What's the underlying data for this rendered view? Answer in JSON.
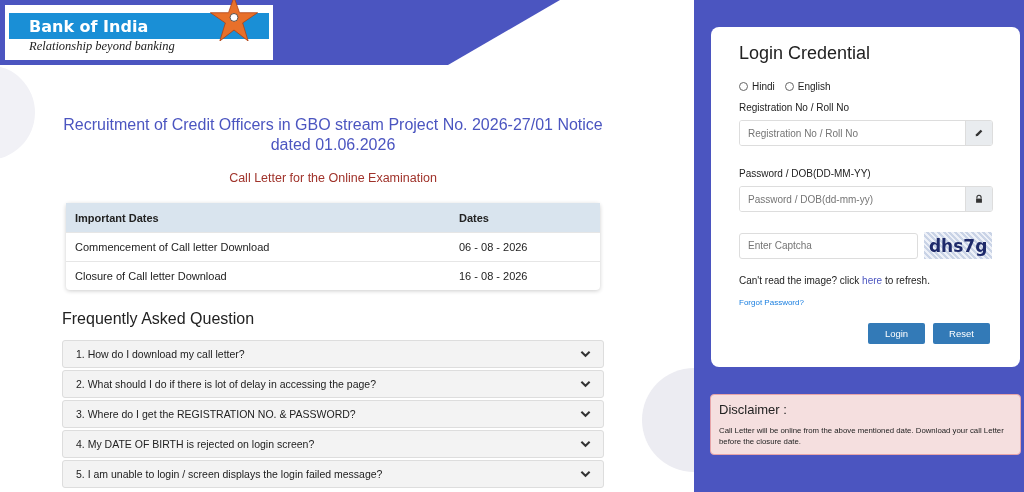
{
  "logo": {
    "name": "Bank of India",
    "tagline": "Relationship beyond banking"
  },
  "notice": {
    "title": "Recruitment of Credit Officers in GBO stream Project No. 2026-27/01 Notice dated 01.06.2026",
    "subtitle": "Call Letter for the Online Examination"
  },
  "dates_table": {
    "columns": [
      "Important Dates",
      "Dates"
    ],
    "rows": [
      [
        "Commencement of Call letter Download",
        "06 - 08 - 2026"
      ],
      [
        "Closure of Call letter Download",
        "16 - 08 - 2026"
      ]
    ]
  },
  "faq": {
    "heading": "Frequently Asked Question",
    "items": [
      {
        "question": "1. How do I download my call letter?",
        "expanded": false
      },
      {
        "question": "2. What should I do if there is lot of delay in accessing the page?",
        "expanded": false
      },
      {
        "question": "3. Where do I get the REGISTRATION NO. & PASSWORD?",
        "expanded": false
      },
      {
        "question": "4. My DATE OF BIRTH is rejected on login screen?",
        "expanded": false
      },
      {
        "question": "5. I am unable to login / screen displays the login failed message?",
        "expanded": false
      }
    ]
  },
  "login": {
    "title": "Login Credential",
    "languages": [
      {
        "label": "Hindi",
        "selected": false
      },
      {
        "label": "English",
        "selected": false
      }
    ],
    "registration": {
      "label": "Registration No / Roll No",
      "placeholder": "Registration No / Roll No"
    },
    "password": {
      "label": "Password / DOB(DD-MM-YY)",
      "placeholder": "Password / DOB(dd-mm-yy)"
    },
    "captcha": {
      "placeholder": "Enter Captcha",
      "code": "dhs7g"
    },
    "refresh": {
      "before": "Can't read the image? click",
      "link": "here",
      "after": "to refresh."
    },
    "forgot": "Forgot Password?",
    "buttons": [
      "Login",
      "Reset"
    ]
  },
  "disclaimer": {
    "title": "Disclaimer :",
    "text": "Call Letter will be online from the above mentioned date. Download your call Letter before the closure date."
  }
}
